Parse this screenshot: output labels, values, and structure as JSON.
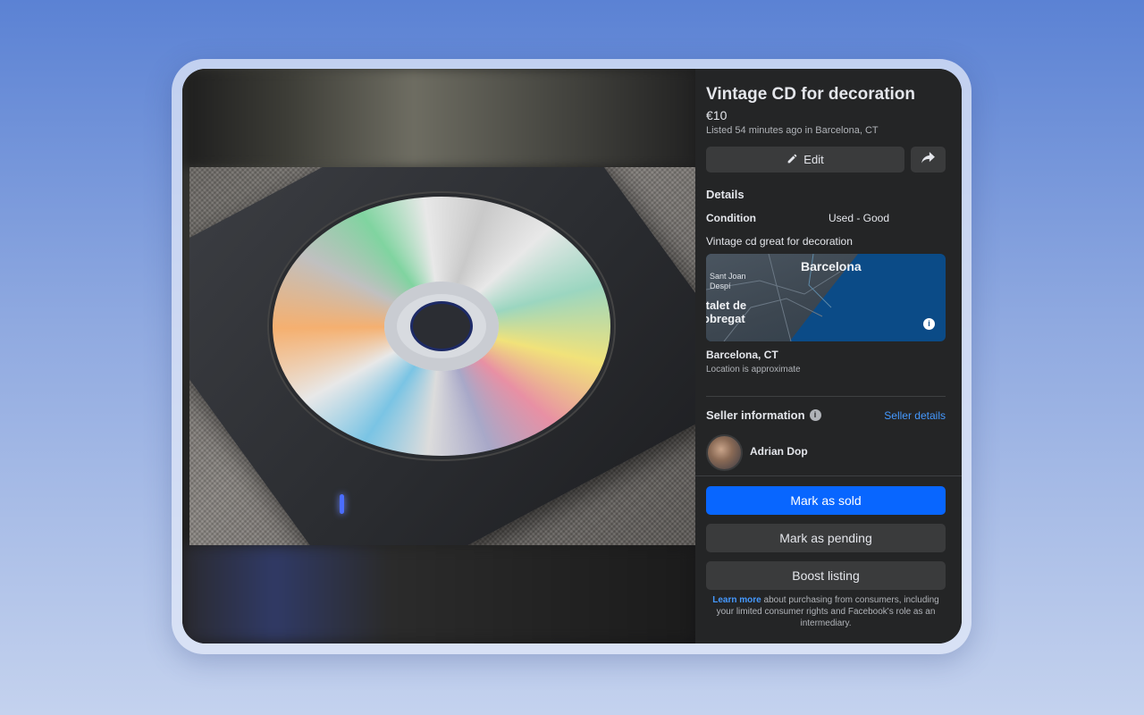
{
  "listing": {
    "title": "Vintage CD for decoration",
    "price": "€10",
    "listed": "Listed 54 minutes ago in Barcelona, CT",
    "edit_label": "Edit",
    "details_heading": "Details",
    "condition_label": "Condition",
    "condition_value": "Used - Good",
    "description": "Vintage cd great for decoration"
  },
  "map": {
    "city": "Barcelona",
    "district_1": "Sant Joan Despí",
    "district_2": "italet de obregat",
    "info_icon": "i"
  },
  "location": {
    "name": "Barcelona, CT",
    "note": "Location is approximate"
  },
  "seller": {
    "heading": "Seller information",
    "details_link": "Seller details",
    "name": "Adrian Dop",
    "info_icon": "i"
  },
  "actions": {
    "mark_sold": "Mark as sold",
    "mark_pending": "Mark as pending",
    "boost": "Boost listing"
  },
  "footer": {
    "learn_more": "Learn more",
    "text": " about purchasing from consumers, including your limited consumer rights and Facebook's role as an intermediary."
  },
  "colors": {
    "primary": "#0866ff",
    "link": "#4599ff",
    "panel_bg": "#242526"
  },
  "icons": {
    "edit": "pencil-icon",
    "share": "share-arrow-icon"
  }
}
